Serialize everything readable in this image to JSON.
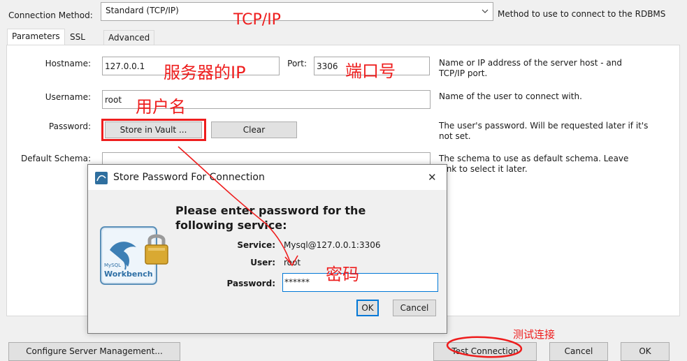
{
  "connection_method": {
    "label": "Connection Method:",
    "value": "Standard (TCP/IP)",
    "description": "Method to use to connect to the RDBMS"
  },
  "tabs": [
    {
      "label": "Parameters"
    },
    {
      "label": "SSL"
    },
    {
      "label": "Advanced"
    }
  ],
  "params": {
    "hostname_label": "Hostname:",
    "hostname_value": "127.0.0.1",
    "port_label": "Port:",
    "port_value": "3306",
    "hostname_desc_1": "Name or IP address of the server host - and",
    "hostname_desc_2": "TCP/IP port.",
    "username_label": "Username:",
    "username_value": "root",
    "username_desc": "Name of the user to connect with.",
    "password_label": "Password:",
    "store_vault_button": "Store in Vault ...",
    "clear_button": "Clear",
    "password_desc_1": "The user's password. Will be requested later if it's",
    "password_desc_2": "not set.",
    "schema_label": "Default Schema:",
    "schema_desc_1": "The schema to use as default schema. Leave",
    "schema_desc_2": "lank to select it later."
  },
  "dialog": {
    "title": "Store Password For Connection",
    "close_glyph": "✕",
    "heading_1": "Please enter password for the",
    "heading_2": "following service:",
    "service_label": "Service:",
    "service_value": "Mysql@127.0.0.1:3306",
    "user_label": "User:",
    "user_value": "root",
    "password_label": "Password:",
    "password_value": "******",
    "ok_button": "OK",
    "cancel_button": "Cancel",
    "logo_text_1": "MySQL",
    "logo_text_2": "Workbench"
  },
  "footer": {
    "configure_button": "Configure Server Management...",
    "test_button": "Test Connection",
    "cancel_button": "Cancel",
    "ok_button": "OK"
  },
  "annotations": {
    "tcpip": "TCP/IP",
    "server_ip": "服务器的IP",
    "port_num": "端口号",
    "username": "用户名",
    "password": "密码",
    "test_connection": "测试连接"
  },
  "colors": {
    "annotation_red": "#ee1d1d",
    "focus_blue": "#0078d7"
  },
  "icons": {
    "dropdown": "chevron-down-icon",
    "dialog_app": "mysql-workbench-icon",
    "logo": "mysql-workbench-logo",
    "lock": "lock-icon",
    "close": "close-icon"
  }
}
